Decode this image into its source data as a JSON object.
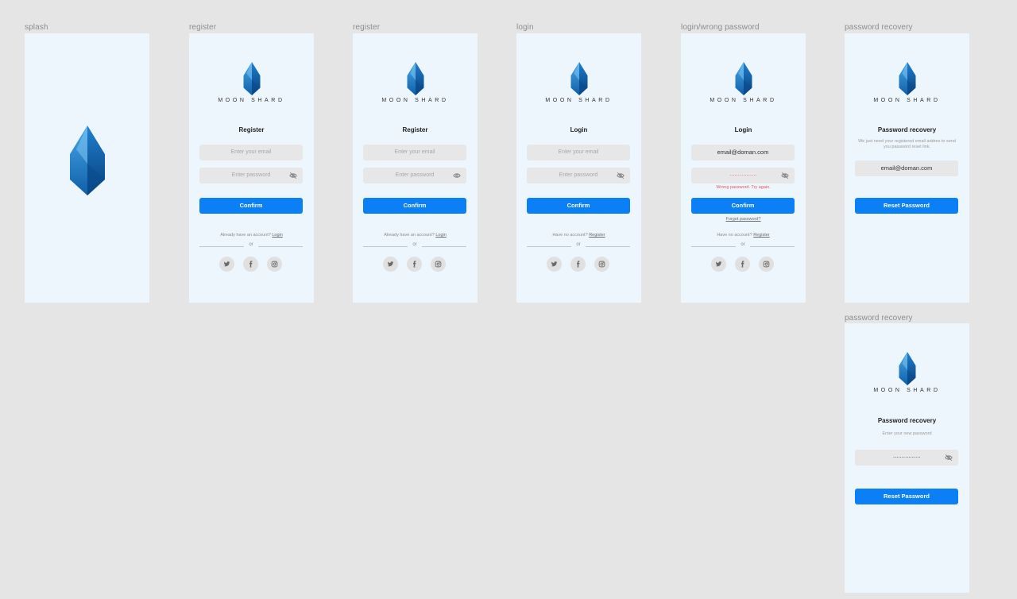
{
  "brand": "MOON SHARD",
  "colors": {
    "accent": "#0b7ff5",
    "frame_bg": "#eef6fd",
    "canvas_bg": "#e5e5e5",
    "error": "#e05a5a"
  },
  "frames": {
    "splash": {
      "label": "splash"
    },
    "register1": {
      "label": "register",
      "title": "Register",
      "email_placeholder": "Enter your email",
      "password_placeholder": "Enter password",
      "confirm": "Confirm",
      "footer_text": "Already have an account?",
      "footer_link": "Login",
      "or": "or"
    },
    "register2": {
      "label": "register",
      "title": "Register",
      "email_placeholder": "Enter your email",
      "password_placeholder": "Enter password",
      "confirm": "Confirm",
      "footer_text": "Already have an account?",
      "footer_link": "Login",
      "or": "or"
    },
    "login": {
      "label": "login",
      "title": "Login",
      "email_placeholder": "Enter your email",
      "password_placeholder": "Enter password",
      "confirm": "Confirm",
      "footer_text": "Have no account?",
      "footer_link": "Register",
      "or": "or"
    },
    "login_wrong": {
      "label": "login/wrong password",
      "title": "Login",
      "email_value": "email@doman.com",
      "password_value": "················",
      "error": "Wrong password. Try again.",
      "confirm": "Confirm",
      "forgot": "Forgot password?",
      "footer_text": "Have no account?",
      "footer_link": "Register",
      "or": "or"
    },
    "recovery1": {
      "label": "password recovery",
      "title": "Password recovery",
      "description": "We just need your registered email addres to send you password reset link.",
      "email_value": "email@doman.com",
      "button": "Reset Password"
    },
    "recovery2": {
      "label": "password recovery",
      "title": "Password recovery",
      "description": "Enter your new password",
      "password_value": "················",
      "button": "Reset Password"
    }
  }
}
